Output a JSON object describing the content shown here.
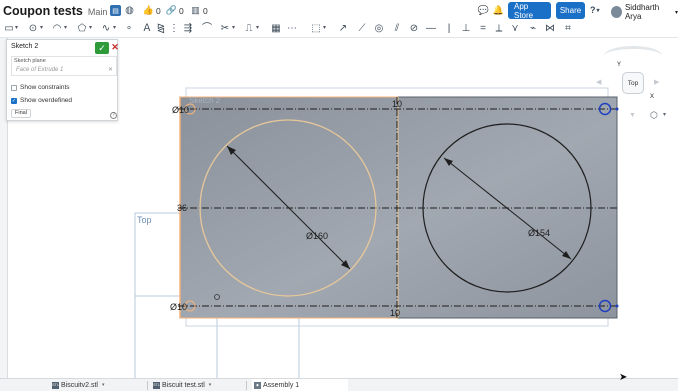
{
  "header": {
    "document_title": "Coupon tests",
    "branch": "Main",
    "likes_count": "0",
    "links_count": "0",
    "versions_count": "0",
    "app_store_label": "App Store",
    "share_label": "Share",
    "help_label": "?",
    "user_name": "Siddharth Arya"
  },
  "sketch_panel": {
    "title": "Sketch 2",
    "confirm_icon": "check-icon",
    "cancel_icon": "close-icon",
    "plane_label": "Sketch plane",
    "plane_value": "Face of Extrude 1",
    "show_constraints_label": "Show constraints",
    "show_constraints_checked": false,
    "show_overdefined_label": "Show overdefined",
    "show_overdefined_checked": true,
    "final_label": "Final",
    "help_icon": "help-icon"
  },
  "canvas": {
    "sketch_label": "Sketch 2",
    "plane_label": "Top",
    "dim_left_top": "Ø10",
    "dim_left_mid": "36",
    "dim_left_bottom": "Ø10",
    "dim_center_top": "10",
    "dim_center_bottom": "10",
    "dim_left_circle": "Ø160",
    "dim_right_circle": "Ø154",
    "colors": {
      "part_face": "#939aa3",
      "selected_circle": "#e8c89a",
      "circle_stroke": "#1e1e1e",
      "constraint_blue": "#1f3fbf",
      "sketch_edge": "#f4b27a"
    }
  },
  "view_cube": {
    "face_label": "Top",
    "axis_y": "Y",
    "axis_x": "X"
  },
  "tabs": [
    {
      "label": "Biscuitv2.stl",
      "icon": "stl-file-icon"
    },
    {
      "label": "Biscuit test.stl",
      "icon": "stl-file-icon"
    },
    {
      "label": "Assembly 1",
      "icon": "assembly-icon"
    }
  ]
}
